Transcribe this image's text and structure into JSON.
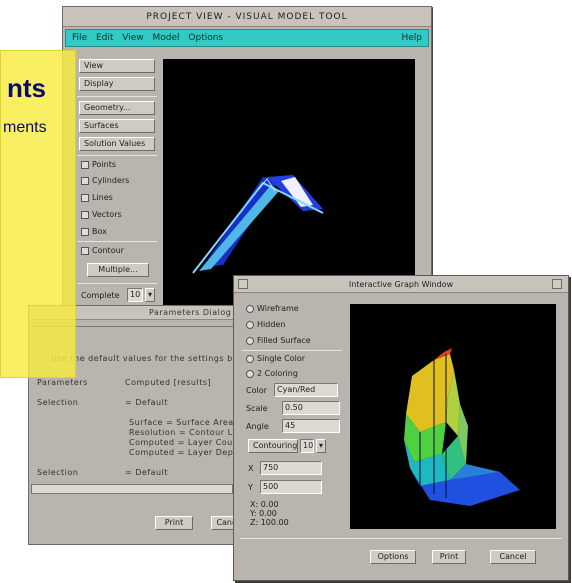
{
  "main_window": {
    "title": "PROJECT VIEW - VISUAL MODEL TOOL",
    "menu": [
      "File",
      "Edit",
      "View",
      "Model",
      "Options"
    ],
    "help": "Help",
    "buttons_top": [
      "View",
      "Display"
    ],
    "buttons_mid": [
      "Geometry...",
      "Surfaces",
      "Solution Values"
    ],
    "options": [
      "Points",
      "Cylinders",
      "Lines",
      "Vectors",
      "Box"
    ],
    "contour_option": "Contour",
    "multiple_button": "Multiple...",
    "complete_label": "Complete",
    "complete_value": "10"
  },
  "overlay": {
    "line1": "nts",
    "line2": "ments"
  },
  "dialog": {
    "title": "Parameters Dialog",
    "header_line": "Use the default values for the settings below",
    "rows": [
      {
        "label": "Parameters",
        "value": "Computed [results]"
      },
      {
        "label": "Selection",
        "value": "= Default"
      },
      {
        "label": "",
        "value": "Surface = Surface Area"
      },
      {
        "label": "",
        "value": "Resolution = Contour Level"
      },
      {
        "label": "",
        "value": "Computed = Layer Count"
      },
      {
        "label": "",
        "value": "Computed = Layer Depth"
      },
      {
        "label": "Selection",
        "value": "= Default"
      }
    ],
    "print_button": "Print",
    "cancel_button": "Cancel"
  },
  "front_window": {
    "title": "Interactive Graph Window",
    "radio_options": [
      "Wireframe",
      "Hidden",
      "Filled Surface"
    ],
    "shading_options": [
      "Single Color",
      "2 Coloring"
    ],
    "color_label": "Color",
    "color_value": "Cyan/Red",
    "scale_label": "Scale",
    "scale_value": "0.50",
    "angle_label": "Angle",
    "angle_value": "45",
    "contour_label": "Contouring",
    "contour_value": "10",
    "x_label": "X",
    "x_value": "750",
    "y_label": "Y",
    "y_value": "500",
    "stats": [
      "X: 0.00",
      "Y: 0.00",
      "Z: 100.00"
    ],
    "options_button": "Options",
    "print_button": "Print",
    "cancel_button": "Cancel"
  },
  "colors": {
    "menubar": "#33c9c4",
    "window_bg": "#b9b4ad",
    "overlay": "#f6ec40"
  }
}
